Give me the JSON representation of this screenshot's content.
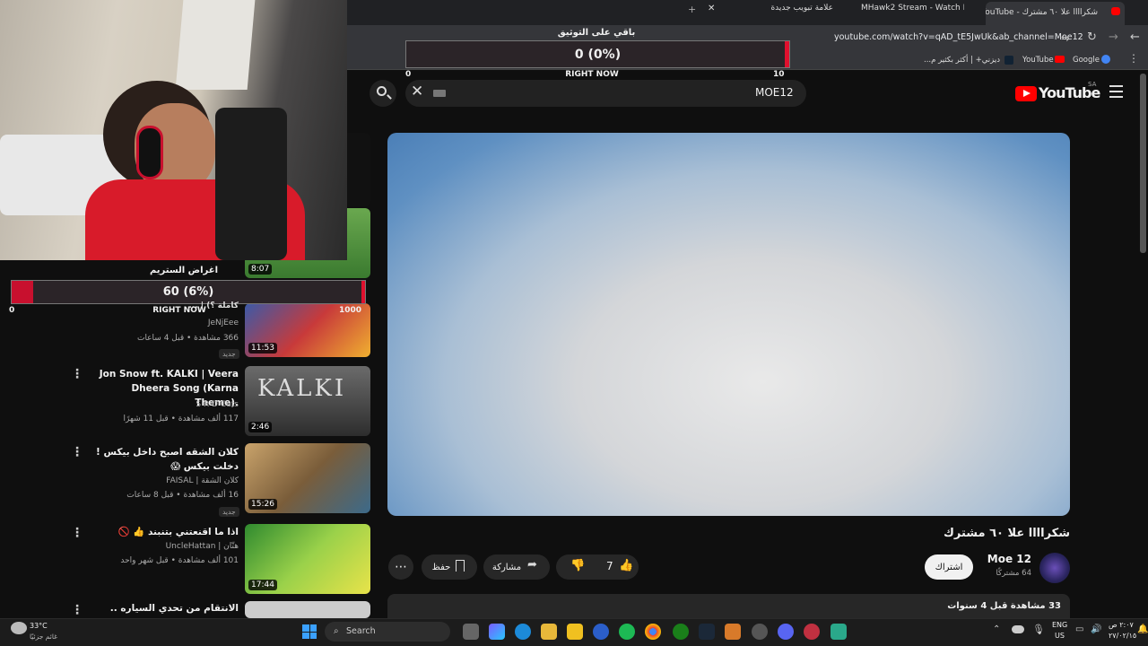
{
  "browser": {
    "tabs": [
      {
        "label": "شكراااا علا ٦٠ مشترك - YouTube",
        "active": true
      },
      {
        "label": "MHawk2 Stream - Watch Live o",
        "active": false
      },
      {
        "label": "علامة تبويب جديدة",
        "active": false
      }
    ],
    "url": "youtube.com/watch?v=qAD_tE5JwUk&ab_channel=Moe12",
    "bookmarks": [
      "Google",
      "YouTube",
      "ديزني+ | أكثر بكثير م..."
    ]
  },
  "overlay_top": {
    "title": "باقي على التوثيق",
    "value": "0 (0%)",
    "fill_fraction": 0.0,
    "min": "0",
    "max": "10",
    "caption": "RIGHT NOW"
  },
  "overlay_left": {
    "title": "اغراض الستريم",
    "value": "60 (6%)",
    "fill_fraction": 0.06,
    "min": "0",
    "max": "1000",
    "caption": "RIGHT NOW"
  },
  "youtube": {
    "logo": "YouTube",
    "region": "SA",
    "search_value": "MOE12",
    "video_title": "شكراااا علا ٦٠ مشترك",
    "channel_name": "Moe 12",
    "subscribers": "64 مشتركًا",
    "subscribe_label": "اشتراك",
    "likes": "7",
    "share_label": "مشاركة",
    "save_label": "حفظ",
    "views_line": "33 مشاهدة قبل 4 سنوات",
    "thumb_top_duration": "8:07"
  },
  "sidebar": [
    {
      "title": "كاملة ؟) | ...",
      "channel": "JeNjEee",
      "meta": "366 مشاهدة • قبل 4 ساعات",
      "badge": "جديد",
      "duration": "11:53"
    },
    {
      "title": "Jon Snow ft. KALKI | Veera Dheera Song (Karna Theme).",
      "channel": "S R D Cuts",
      "meta": "117 ألف مشاهدة • قبل 11 شهرًا",
      "badge": "",
      "duration": "2:46"
    },
    {
      "title": "كلان الشقه اصبح داخل بيكس ! دخلت بيكس 😱",
      "channel": "كلان الشقة | FAISAL",
      "meta": "16 ألف مشاهدة • قبل 8 ساعات",
      "badge": "جديد",
      "duration": "15:26"
    },
    {
      "title": "اذا ما اقنعتني بتنبند 👍 🚫",
      "channel": "هتّان | UncleHattan",
      "meta": "101 ألف مشاهدة • قبل شهر واحد",
      "badge": "",
      "duration": "17:44"
    },
    {
      "title": "الانتقام من تحدي السياره ..",
      "channel": "",
      "meta": "",
      "badge": "",
      "duration": ""
    }
  ],
  "taskbar": {
    "weather_temp": "33°C",
    "weather_desc": "غائم جزئيًا",
    "search_placeholder": "Search",
    "lang": "ENG",
    "region": "US",
    "time": "٢:٠٧ ص",
    "date": "٢٧/٠٢/١٥"
  }
}
